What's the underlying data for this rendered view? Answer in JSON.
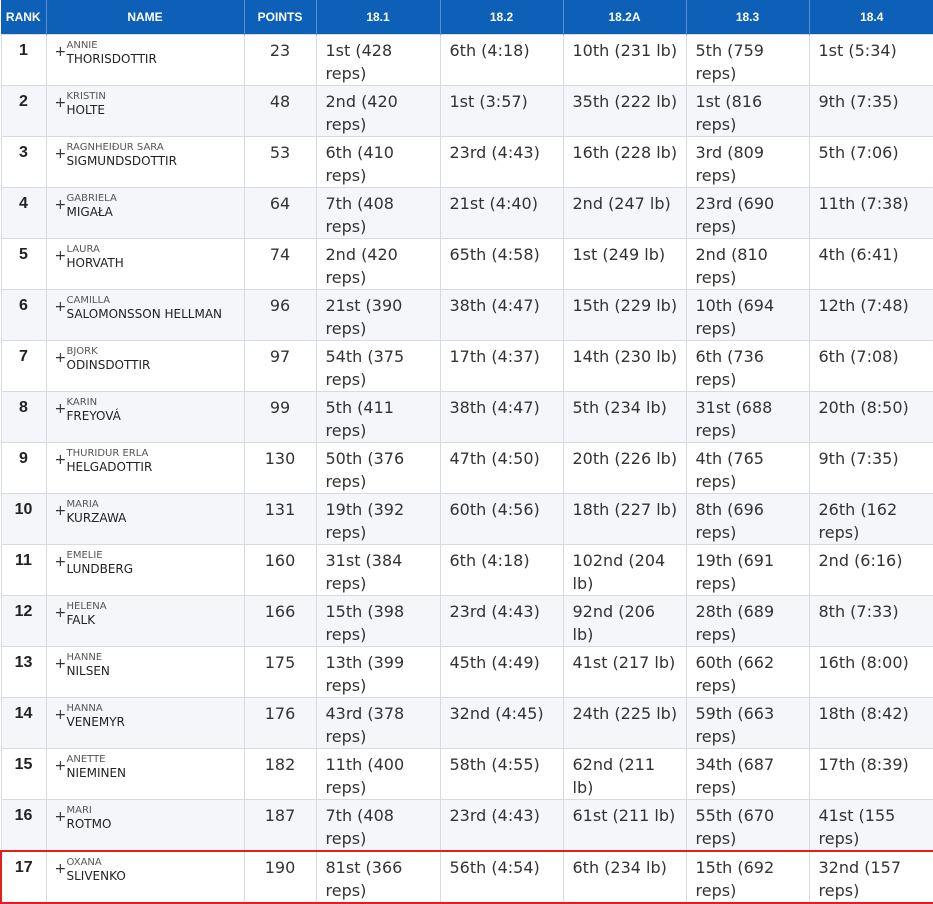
{
  "headers": [
    "RANK",
    "NAME",
    "POINTS",
    "18.1",
    "18.2",
    "18.2A",
    "18.3",
    "18.4"
  ],
  "rows": [
    {
      "rank": "1",
      "first": "ANNIE",
      "last": "THORISDOTTIR",
      "points": "23",
      "e1": "1st (428 reps)",
      "e2": "6th (4:18)",
      "e3": "10th (231 lb)",
      "e4": "5th (759 reps)",
      "e5": "1st (5:34)"
    },
    {
      "rank": "2",
      "first": "KRISTIN",
      "last": "HOLTE",
      "points": "48",
      "e1": "2nd (420 reps)",
      "e2": "1st (3:57)",
      "e3": "35th (222 lb)",
      "e4": "1st (816 reps)",
      "e5": "9th (7:35)"
    },
    {
      "rank": "3",
      "first": "RAGNHEIÐUR SARA",
      "last": "SIGMUNDSDOTTIR",
      "points": "53",
      "e1": "6th (410 reps)",
      "e2": "23rd (4:43)",
      "e3": "16th (228 lb)",
      "e4": "3rd (809 reps)",
      "e5": "5th (7:06)"
    },
    {
      "rank": "4",
      "first": "GABRIELA",
      "last": "MIGAŁA",
      "points": "64",
      "e1": "7th (408 reps)",
      "e2": "21st (4:40)",
      "e3": "2nd (247 lb)",
      "e4": "23rd (690 reps)",
      "e5": "11th (7:38)"
    },
    {
      "rank": "5",
      "first": "LAURA",
      "last": "HORVATH",
      "points": "74",
      "e1": "2nd (420 reps)",
      "e2": "65th (4:58)",
      "e3": "1st (249 lb)",
      "e4": "2nd (810 reps)",
      "e5": "4th (6:41)"
    },
    {
      "rank": "6",
      "first": "CAMILLA",
      "last": "SALOMONSSON HELLMAN",
      "points": "96",
      "e1": "21st (390 reps)",
      "e2": "38th (4:47)",
      "e3": "15th (229 lb)",
      "e4": "10th (694 reps)",
      "e5": "12th (7:48)"
    },
    {
      "rank": "7",
      "first": "BJORK",
      "last": "ODINSDOTTIR",
      "points": "97",
      "e1": "54th (375 reps)",
      "e2": "17th (4:37)",
      "e3": "14th (230 lb)",
      "e4": "6th (736 reps)",
      "e5": "6th (7:08)"
    },
    {
      "rank": "8",
      "first": "KARIN",
      "last": "FREYOVÁ",
      "points": "99",
      "e1": "5th (411 reps)",
      "e2": "38th (4:47)",
      "e3": "5th (234 lb)",
      "e4": "31st (688 reps)",
      "e5": "20th (8:50)"
    },
    {
      "rank": "9",
      "first": "THURIDUR ERLA",
      "last": "HELGADOTTIR",
      "points": "130",
      "e1": "50th (376 reps)",
      "e2": "47th (4:50)",
      "e3": "20th (226 lb)",
      "e4": "4th (765 reps)",
      "e5": "9th (7:35)"
    },
    {
      "rank": "10",
      "first": "MARIA",
      "last": "KURZAWA",
      "points": "131",
      "e1": "19th (392 reps)",
      "e2": "60th (4:56)",
      "e3": "18th (227 lb)",
      "e4": "8th (696 reps)",
      "e5": "26th (162 reps)"
    },
    {
      "rank": "11",
      "first": "EMELIE",
      "last": "LUNDBERG",
      "points": "160",
      "e1": "31st (384 reps)",
      "e2": "6th (4:18)",
      "e3": "102nd (204 lb)",
      "e4": "19th (691 reps)",
      "e5": "2nd (6:16)"
    },
    {
      "rank": "12",
      "first": "HELENA",
      "last": "FALK",
      "points": "166",
      "e1": "15th (398 reps)",
      "e2": "23rd (4:43)",
      "e3": "92nd (206 lb)",
      "e4": "28th (689 reps)",
      "e5": "8th (7:33)"
    },
    {
      "rank": "13",
      "first": "HANNE",
      "last": "NILSEN",
      "points": "175",
      "e1": "13th (399 reps)",
      "e2": "45th (4:49)",
      "e3": "41st (217 lb)",
      "e4": "60th (662 reps)",
      "e5": "16th (8:00)"
    },
    {
      "rank": "14",
      "first": "HANNA",
      "last": "VENEMYR",
      "points": "176",
      "e1": "43rd (378 reps)",
      "e2": "32nd (4:45)",
      "e3": "24th (225 lb)",
      "e4": "59th (663 reps)",
      "e5": "18th (8:42)"
    },
    {
      "rank": "15",
      "first": "ANETTE",
      "last": "NIEMINEN",
      "points": "182",
      "e1": "11th (400 reps)",
      "e2": "58th (4:55)",
      "e3": "62nd (211 lb)",
      "e4": "34th (687 reps)",
      "e5": "17th (8:39)"
    },
    {
      "rank": "16",
      "first": "MARI",
      "last": "ROTMO",
      "points": "187",
      "e1": "7th (408 reps)",
      "e2": "23rd (4:43)",
      "e3": "61st (211 lb)",
      "e4": "55th (670 reps)",
      "e5": "41st (155 reps)"
    },
    {
      "rank": "17",
      "first": "OXANA",
      "last": "SLIVENKO",
      "points": "190",
      "e1": "81st (366 reps)",
      "e2": "56th (4:54)",
      "e3": "6th (234 lb)",
      "e4": "15th (692 reps)",
      "e5": "32nd (157 reps)",
      "highlight": true
    }
  ],
  "expand_icon": "plus-icon",
  "colors": {
    "header_bg": "#0d5fb8",
    "highlight_border": "#e0201e",
    "row_alt": "#f4f6f9"
  }
}
